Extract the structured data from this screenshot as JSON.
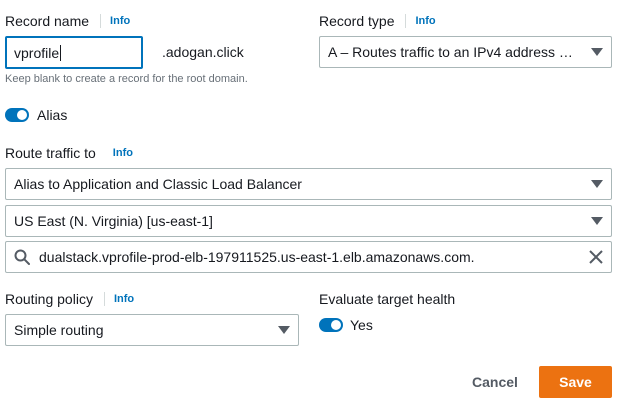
{
  "record_name": {
    "label": "Record name",
    "info": "Info",
    "value": "vprofile",
    "domain_suffix": ".adogan.click",
    "helper": "Keep blank to create a record for the root domain."
  },
  "record_type": {
    "label": "Record type",
    "info": "Info",
    "value": "A – Routes traffic to an IPv4 address …"
  },
  "alias": {
    "label": "Alias",
    "enabled": true
  },
  "route_traffic": {
    "label": "Route traffic to",
    "info": "Info",
    "endpoint_type": "Alias to Application and Classic Load Balancer",
    "region": "US East (N. Virginia) [us-east-1]",
    "endpoint_value": "dualstack.vprofile-prod-elb-197911525.us-east-1.elb.amazonaws.com."
  },
  "routing_policy": {
    "label": "Routing policy",
    "info": "Info",
    "value": "Simple routing"
  },
  "evaluate_health": {
    "label": "Evaluate target health",
    "toggle_label": "Yes",
    "enabled": true
  },
  "actions": {
    "cancel": "Cancel",
    "save": "Save"
  },
  "icons": {
    "search": "search-icon",
    "clear": "close-icon",
    "dropdown": "chevron-down-icon"
  },
  "colors": {
    "accent": "#0073bb",
    "primary_button": "#ec7211"
  }
}
